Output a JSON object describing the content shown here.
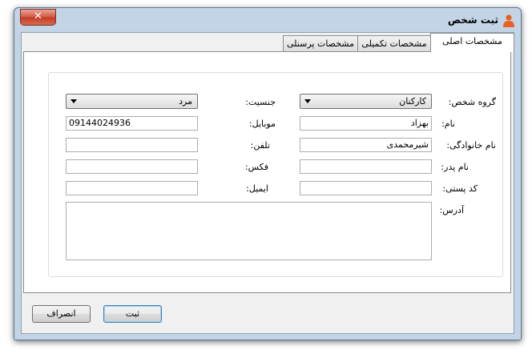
{
  "window": {
    "title": "ثبت شخص",
    "close_glyph": "✕"
  },
  "tabs": [
    {
      "label": "مشخصات اصلی",
      "active": true
    },
    {
      "label": "مشخصات تکمیلی",
      "active": false
    },
    {
      "label": "مشخصات پرسنلی",
      "active": false
    }
  ],
  "form": {
    "group_label": "گروه شخص:",
    "group_value": "کارکنان",
    "name_label": "نام:",
    "name_value": "بهزاد",
    "family_label": "نام خانوادگی:",
    "family_value": "شیرمحمدی",
    "father_label": "نام پدر:",
    "father_value": "",
    "postal_label": "کد پستی:",
    "postal_value": "",
    "address_label": "آدرس:",
    "address_value": "",
    "gender_label": "جنسیت:",
    "gender_value": "مرد",
    "mobile_label": "موبایل:",
    "mobile_value": "09144024936",
    "phone_label": "تلفن:",
    "phone_value": "",
    "fax_label": "فکس:",
    "fax_value": "",
    "email_label": "ایمیل:",
    "email_value": ""
  },
  "buttons": {
    "submit_label": "ثبت",
    "cancel_label": "انصراف"
  },
  "icons": {
    "title": "user-icon",
    "close": "close-icon",
    "dropdown": "dropdown-arrow-icon"
  },
  "colors": {
    "frame": "#c3d4e7",
    "close_button": "#c94a32",
    "user_icon": "#e8621f"
  }
}
